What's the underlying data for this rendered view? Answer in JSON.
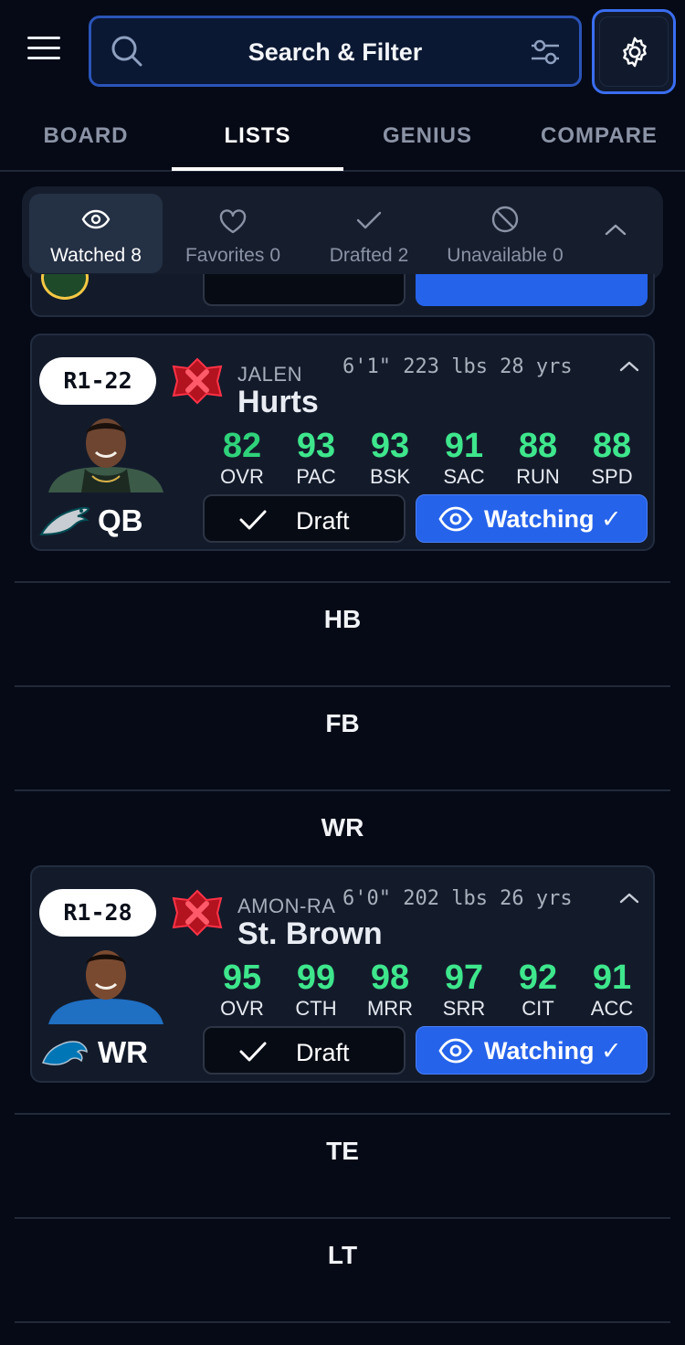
{
  "header": {
    "search_label": "Search & Filter"
  },
  "tabs": [
    {
      "label": "BOARD"
    },
    {
      "label": "LISTS"
    },
    {
      "label": "GENIUS"
    },
    {
      "label": "COMPARE"
    }
  ],
  "filters": [
    {
      "label": "Watched",
      "count": "8"
    },
    {
      "label": "Favorites",
      "count": "0"
    },
    {
      "label": "Drafted",
      "count": "2"
    },
    {
      "label": "Unavailable",
      "count": "0"
    }
  ],
  "players": [
    {
      "pick": "R1-22",
      "first_name": "JALEN",
      "last_name": "Hurts",
      "measurements": "6'1\" 223 lbs 28 yrs",
      "position": "QB",
      "team_color": "#004c54",
      "stats": [
        {
          "value": "82",
          "label": "OVR"
        },
        {
          "value": "93",
          "label": "PAC"
        },
        {
          "value": "93",
          "label": "BSK"
        },
        {
          "value": "91",
          "label": "SAC"
        },
        {
          "value": "88",
          "label": "RUN"
        },
        {
          "value": "88",
          "label": "SPD"
        }
      ],
      "draft_label": "Draft",
      "watch_label": "Watching ✓"
    },
    {
      "pick": "R1-28",
      "first_name": "AMON-RA",
      "last_name": "St. Brown",
      "measurements": "6'0\" 202 lbs 26 yrs",
      "position": "WR",
      "team_color": "#0076b6",
      "stats": [
        {
          "value": "95",
          "label": "OVR"
        },
        {
          "value": "99",
          "label": "CTH"
        },
        {
          "value": "98",
          "label": "MRR"
        },
        {
          "value": "97",
          "label": "SRR"
        },
        {
          "value": "92",
          "label": "CIT"
        },
        {
          "value": "91",
          "label": "ACC"
        }
      ],
      "draft_label": "Draft",
      "watch_label": "Watching ✓"
    }
  ],
  "sections": [
    {
      "title": "HB"
    },
    {
      "title": "FB"
    },
    {
      "title": "WR"
    },
    {
      "title": "TE"
    },
    {
      "title": "LT"
    }
  ],
  "colors": {
    "accent": "#2563eb",
    "stat_green": "#3ee68c",
    "background": "#050a16"
  }
}
